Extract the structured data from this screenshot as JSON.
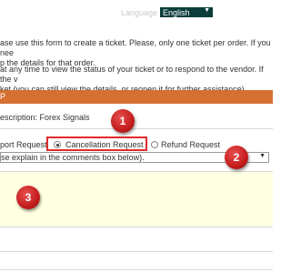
{
  "language": {
    "label": "Language",
    "selected": "English"
  },
  "info": {
    "line1": "ase use this form to create a ticket. Please, only one ticket per order. If you nee",
    "line2": "p the details for that order.",
    "line3": "at any time to view the status of your ticket or to respond to the vendor. If the v",
    "line4": "ket (you can still view the details, or reopen it for further assistance)."
  },
  "header": {
    "title": "P"
  },
  "description": {
    "text": "escription: Forex Signals"
  },
  "request_type": {
    "option_support": "port Request",
    "option_cancellation": "Cancellation Request",
    "option_refund": "Refund Request"
  },
  "reason_select": {
    "value": "se explain in the comments box below)."
  },
  "markers": {
    "m1": "1",
    "m2": "2",
    "m3": "3"
  },
  "colors": {
    "header": "#d66f32",
    "highlight": "#e02b2b",
    "comments_bg": "#ffffe2"
  }
}
